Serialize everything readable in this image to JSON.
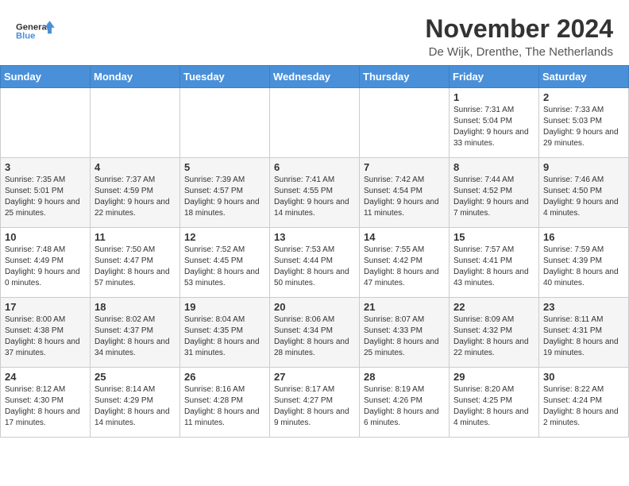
{
  "logo": {
    "line1": "General",
    "line2": "Blue"
  },
  "title": "November 2024",
  "location": "De Wijk, Drenthe, The Netherlands",
  "days_of_week": [
    "Sunday",
    "Monday",
    "Tuesday",
    "Wednesday",
    "Thursday",
    "Friday",
    "Saturday"
  ],
  "weeks": [
    [
      {
        "day": "",
        "info": ""
      },
      {
        "day": "",
        "info": ""
      },
      {
        "day": "",
        "info": ""
      },
      {
        "day": "",
        "info": ""
      },
      {
        "day": "",
        "info": ""
      },
      {
        "day": "1",
        "info": "Sunrise: 7:31 AM\nSunset: 5:04 PM\nDaylight: 9 hours and 33 minutes."
      },
      {
        "day": "2",
        "info": "Sunrise: 7:33 AM\nSunset: 5:03 PM\nDaylight: 9 hours and 29 minutes."
      }
    ],
    [
      {
        "day": "3",
        "info": "Sunrise: 7:35 AM\nSunset: 5:01 PM\nDaylight: 9 hours and 25 minutes."
      },
      {
        "day": "4",
        "info": "Sunrise: 7:37 AM\nSunset: 4:59 PM\nDaylight: 9 hours and 22 minutes."
      },
      {
        "day": "5",
        "info": "Sunrise: 7:39 AM\nSunset: 4:57 PM\nDaylight: 9 hours and 18 minutes."
      },
      {
        "day": "6",
        "info": "Sunrise: 7:41 AM\nSunset: 4:55 PM\nDaylight: 9 hours and 14 minutes."
      },
      {
        "day": "7",
        "info": "Sunrise: 7:42 AM\nSunset: 4:54 PM\nDaylight: 9 hours and 11 minutes."
      },
      {
        "day": "8",
        "info": "Sunrise: 7:44 AM\nSunset: 4:52 PM\nDaylight: 9 hours and 7 minutes."
      },
      {
        "day": "9",
        "info": "Sunrise: 7:46 AM\nSunset: 4:50 PM\nDaylight: 9 hours and 4 minutes."
      }
    ],
    [
      {
        "day": "10",
        "info": "Sunrise: 7:48 AM\nSunset: 4:49 PM\nDaylight: 9 hours and 0 minutes."
      },
      {
        "day": "11",
        "info": "Sunrise: 7:50 AM\nSunset: 4:47 PM\nDaylight: 8 hours and 57 minutes."
      },
      {
        "day": "12",
        "info": "Sunrise: 7:52 AM\nSunset: 4:45 PM\nDaylight: 8 hours and 53 minutes."
      },
      {
        "day": "13",
        "info": "Sunrise: 7:53 AM\nSunset: 4:44 PM\nDaylight: 8 hours and 50 minutes."
      },
      {
        "day": "14",
        "info": "Sunrise: 7:55 AM\nSunset: 4:42 PM\nDaylight: 8 hours and 47 minutes."
      },
      {
        "day": "15",
        "info": "Sunrise: 7:57 AM\nSunset: 4:41 PM\nDaylight: 8 hours and 43 minutes."
      },
      {
        "day": "16",
        "info": "Sunrise: 7:59 AM\nSunset: 4:39 PM\nDaylight: 8 hours and 40 minutes."
      }
    ],
    [
      {
        "day": "17",
        "info": "Sunrise: 8:00 AM\nSunset: 4:38 PM\nDaylight: 8 hours and 37 minutes."
      },
      {
        "day": "18",
        "info": "Sunrise: 8:02 AM\nSunset: 4:37 PM\nDaylight: 8 hours and 34 minutes."
      },
      {
        "day": "19",
        "info": "Sunrise: 8:04 AM\nSunset: 4:35 PM\nDaylight: 8 hours and 31 minutes."
      },
      {
        "day": "20",
        "info": "Sunrise: 8:06 AM\nSunset: 4:34 PM\nDaylight: 8 hours and 28 minutes."
      },
      {
        "day": "21",
        "info": "Sunrise: 8:07 AM\nSunset: 4:33 PM\nDaylight: 8 hours and 25 minutes."
      },
      {
        "day": "22",
        "info": "Sunrise: 8:09 AM\nSunset: 4:32 PM\nDaylight: 8 hours and 22 minutes."
      },
      {
        "day": "23",
        "info": "Sunrise: 8:11 AM\nSunset: 4:31 PM\nDaylight: 8 hours and 19 minutes."
      }
    ],
    [
      {
        "day": "24",
        "info": "Sunrise: 8:12 AM\nSunset: 4:30 PM\nDaylight: 8 hours and 17 minutes."
      },
      {
        "day": "25",
        "info": "Sunrise: 8:14 AM\nSunset: 4:29 PM\nDaylight: 8 hours and 14 minutes."
      },
      {
        "day": "26",
        "info": "Sunrise: 8:16 AM\nSunset: 4:28 PM\nDaylight: 8 hours and 11 minutes."
      },
      {
        "day": "27",
        "info": "Sunrise: 8:17 AM\nSunset: 4:27 PM\nDaylight: 8 hours and 9 minutes."
      },
      {
        "day": "28",
        "info": "Sunrise: 8:19 AM\nSunset: 4:26 PM\nDaylight: 8 hours and 6 minutes."
      },
      {
        "day": "29",
        "info": "Sunrise: 8:20 AM\nSunset: 4:25 PM\nDaylight: 8 hours and 4 minutes."
      },
      {
        "day": "30",
        "info": "Sunrise: 8:22 AM\nSunset: 4:24 PM\nDaylight: 8 hours and 2 minutes."
      }
    ]
  ]
}
